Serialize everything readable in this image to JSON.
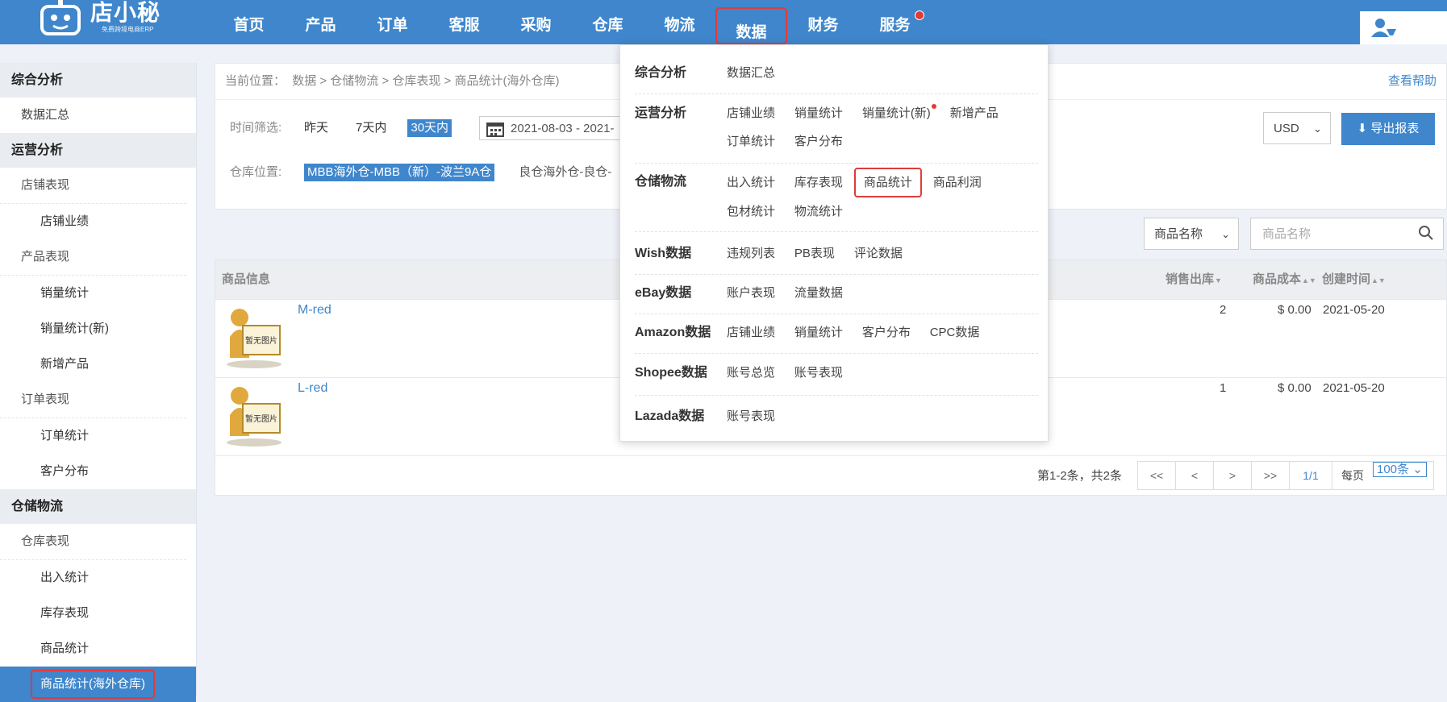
{
  "logo": {
    "title": "店小秘",
    "subtitle": "免费跨境电商ERP"
  },
  "nav": {
    "items": [
      "首页",
      "产品",
      "订单",
      "客服",
      "采购",
      "仓库",
      "物流",
      "数据",
      "财务",
      "服务"
    ],
    "active": "数据"
  },
  "sidebar": {
    "group_overview": "综合分析",
    "data_summary": "数据汇总",
    "group_ops": "运营分析",
    "store_perf": "店铺表现",
    "store_results": "店铺业绩",
    "product_perf": "产品表现",
    "sales_stats": "销量统计",
    "sales_stats_new": "销量统计(新)",
    "new_products": "新增产品",
    "order_perf": "订单表现",
    "order_stats": "订单统计",
    "customer_dist": "客户分布",
    "group_wh": "仓储物流",
    "wh_perf": "仓库表现",
    "inout_stats": "出入统计",
    "stock_perf": "库存表现",
    "goods_stats": "商品统计",
    "goods_stats_overseas": "商品统计(海外仓库)"
  },
  "breadcrumb": {
    "prefix": "当前位置：",
    "path": "数据 > 仓储物流 > 仓库表现 > 商品统计(海外仓库)",
    "help": "查看帮助"
  },
  "filters": {
    "time_label": "时间筛选:",
    "opt_yesterday": "昨天",
    "opt_7days": "7天内",
    "opt_30days": "30天内",
    "date_range": "2021-08-03 - 2021-",
    "wh_label": "仓库位置:",
    "wh_selected": "MBB海外仓-MBB（新）-波兰9A仓",
    "wh_other": "良仓海外仓-良仓-"
  },
  "toolbar": {
    "currency": "USD",
    "export": "导出报表",
    "search_field": "商品名称",
    "search_placeholder": "商品名称"
  },
  "table": {
    "headers": {
      "info": "商品信息",
      "sales_out": "销售出库",
      "cost": "商品成本",
      "created": "创建时间"
    },
    "no_image": "暂无图片",
    "rows": [
      {
        "sku": "M-red",
        "sales_out": "2",
        "cost": "$ 0.00",
        "created": "2021-05-20"
      },
      {
        "sku": "L-red",
        "sales_out": "1",
        "cost": "$ 0.00",
        "created": "2021-05-20"
      }
    ]
  },
  "pager": {
    "info": "第1-2条，共2条",
    "first": "<<",
    "prev": "<",
    "next": ">",
    "last": ">>",
    "page": "1/1",
    "per_label": "每页",
    "per_value": "100条"
  },
  "menu": {
    "overview": {
      "cat": "综合分析",
      "links": [
        "数据汇总"
      ]
    },
    "ops": {
      "cat": "运营分析",
      "links": [
        "店铺业绩",
        "销量统计",
        "销量统计(新)",
        "新增产品",
        "订单统计",
        "客户分布"
      ]
    },
    "wh": {
      "cat": "仓储物流",
      "links": [
        "出入统计",
        "库存表现",
        "商品统计",
        "商品利润",
        "包材统计",
        "物流统计"
      ]
    },
    "wish": {
      "cat": "Wish数据",
      "links": [
        "违规列表",
        "PB表现",
        "评论数据"
      ]
    },
    "ebay": {
      "cat": "eBay数据",
      "links": [
        "账户表现",
        "流量数据"
      ]
    },
    "amazon": {
      "cat": "Amazon数据",
      "links": [
        "店铺业绩",
        "销量统计",
        "客户分布",
        "CPC数据"
      ]
    },
    "shopee": {
      "cat": "Shopee数据",
      "links": [
        "账号总览",
        "账号表现"
      ]
    },
    "lazada": {
      "cat": "Lazada数据",
      "links": [
        "账号表现"
      ]
    }
  },
  "colors": {
    "brand": "#3f86cc",
    "highlight": "#e03b3b"
  }
}
